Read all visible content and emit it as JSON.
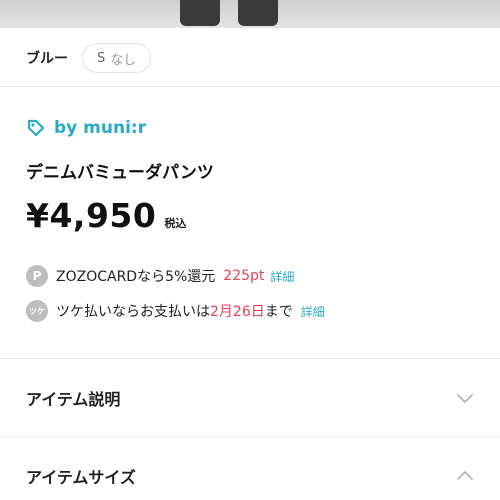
{
  "variant": {
    "color": "ブルー",
    "size_code": "S",
    "stock": "なし"
  },
  "brand": {
    "icon": "tag-icon",
    "name": "by muni:r"
  },
  "product": {
    "name": "デニムバミューダパンツ",
    "price": "¥4,950",
    "tax_label": "税込"
  },
  "zozocard": {
    "icon_letter": "P",
    "text": "ZOZOCARDなら5%還元",
    "points": "225pt",
    "detail": "詳細"
  },
  "tsuke": {
    "icon_letter": "ツケ",
    "text_before": "ツケ払いならお支払いは",
    "due_date": "2月26日",
    "text_after": "まで",
    "detail": "詳細"
  },
  "accordions": [
    {
      "label": "アイテム説明",
      "icon": "chevron-down-icon"
    },
    {
      "label": "アイテムサイズ",
      "icon": "chevron-up-icon"
    }
  ],
  "colors": {
    "accent": "#2aa9c9",
    "highlight": "#e0435c"
  }
}
